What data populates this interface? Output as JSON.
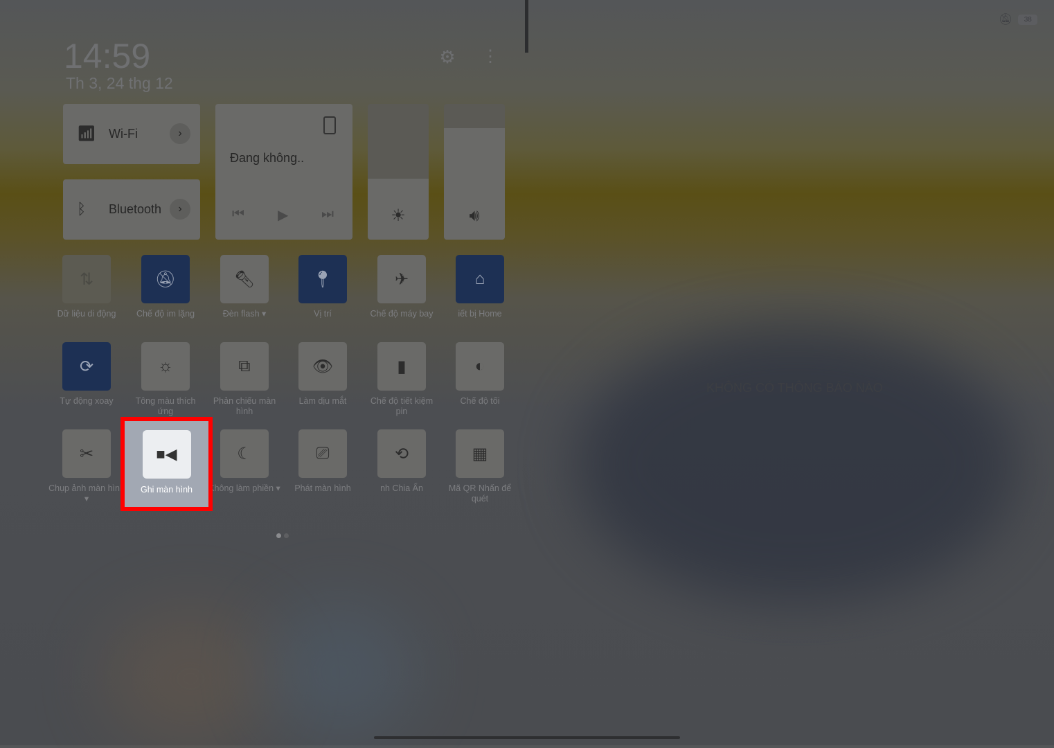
{
  "status": {
    "dnd_icon": "bell-off-icon",
    "battery": "38"
  },
  "header": {
    "time": "14:59",
    "date": "Th 3, 24 thg 12",
    "settings_icon": "gear-icon",
    "more_icon": "more-vertical-icon"
  },
  "wifi": {
    "label": "Wi-Fi"
  },
  "bluetooth": {
    "label": "Bluetooth"
  },
  "media": {
    "title": "Đang không.."
  },
  "brightness": {
    "level": 0.45
  },
  "volume": {
    "level": 0.82
  },
  "tiles": [
    {
      "label": "Dữ liệu di động",
      "state": "disabled"
    },
    {
      "label": "Chế độ im lặng",
      "state": "on"
    },
    {
      "label": "Đèn flash ▾",
      "state": "off"
    },
    {
      "label": "Vị trí",
      "state": "on"
    },
    {
      "label": "Chế độ máy bay",
      "state": "off"
    },
    {
      "label": "iết bị Home",
      "state": "on"
    },
    {
      "label": "Tự động xoay",
      "state": "on"
    },
    {
      "label": "Tông màu thích ứng",
      "state": "off"
    },
    {
      "label": "Phản chiếu màn hình",
      "state": "off"
    },
    {
      "label": "Làm dịu mắt",
      "state": "off"
    },
    {
      "label": "Chế độ tiết kiệm pin",
      "state": "off"
    },
    {
      "label": "Chế độ tối",
      "state": "off"
    },
    {
      "label": "Chụp ảnh màn hình ▾",
      "state": "off"
    },
    {
      "label": "Ghi màn hình",
      "state": "highlighted"
    },
    {
      "label": "Không làm phiền ▾",
      "state": "off"
    },
    {
      "label": "Phát màn hình",
      "state": "off"
    },
    {
      "label": "nh Chia Ẩn",
      "state": "off"
    },
    {
      "label": "Mã QR Nhấn để quét",
      "state": "off"
    }
  ],
  "notifications": {
    "empty": "KHÔNG CÓ THÔNG BÁO NÀO"
  },
  "highlight_color": "#ff0000"
}
